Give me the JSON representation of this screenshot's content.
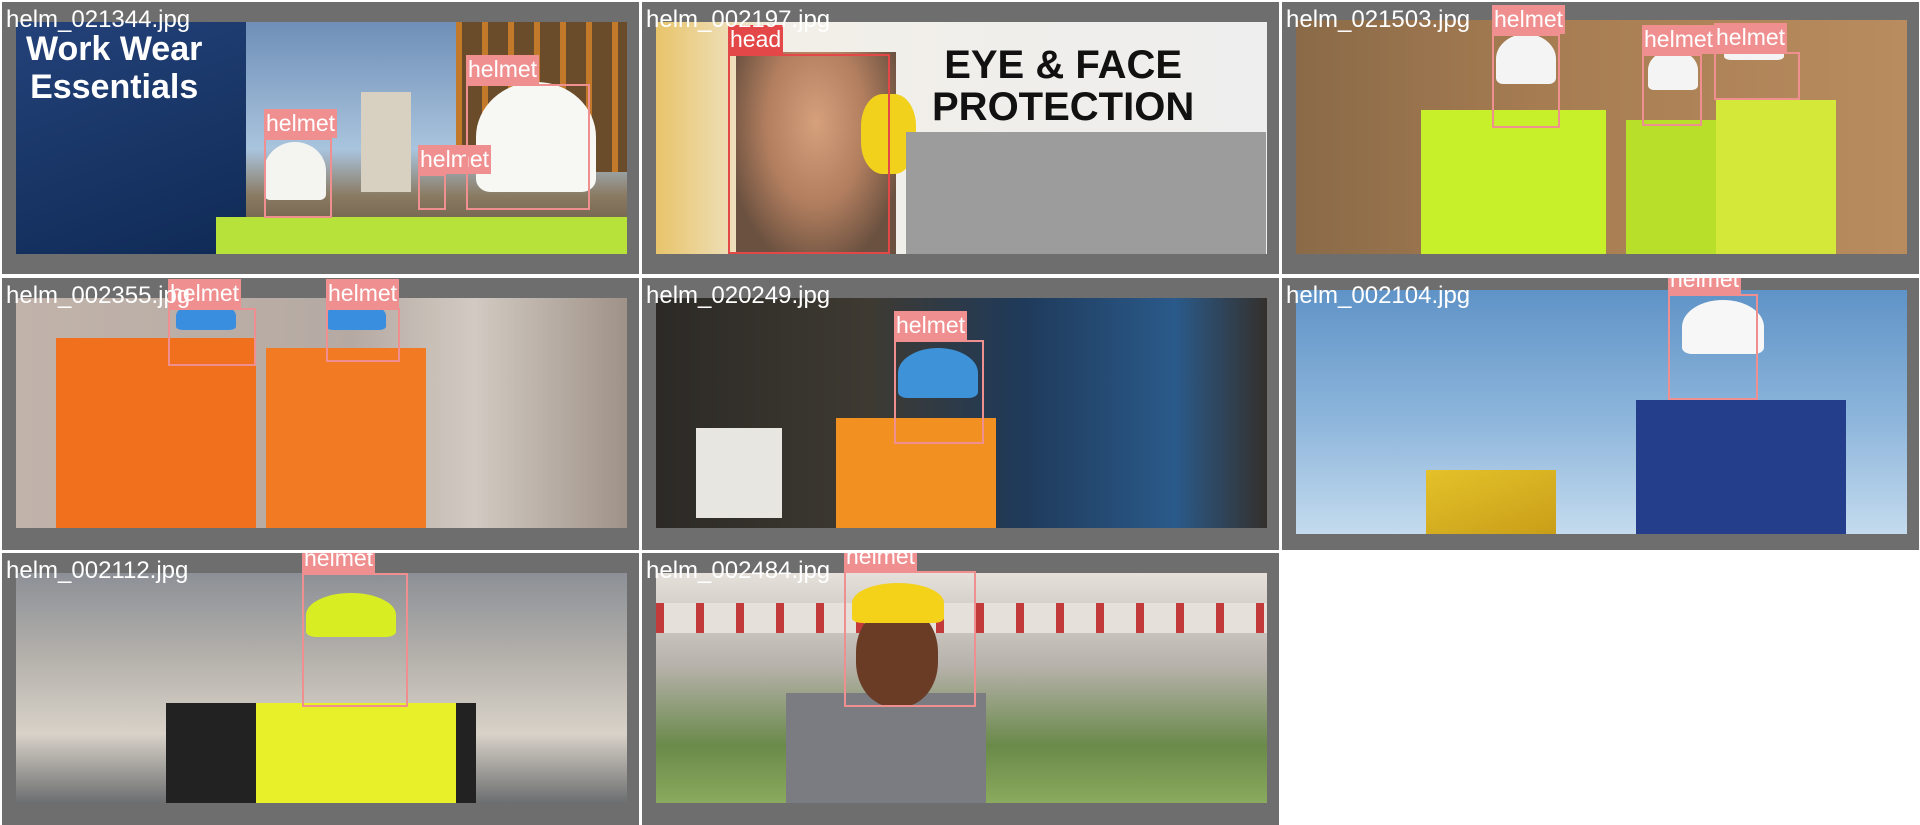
{
  "colors": {
    "cell_bg": "#6e6e6e",
    "helmet_box": "#f08f8f",
    "head_box": "#e34747",
    "label_text": "#ffffff"
  },
  "tiles": [
    {
      "filename": "helm_021344.jpg",
      "overlay_text": "Work Wear\nEssentials",
      "detections": [
        {
          "label": "helmet",
          "class": "helmet"
        },
        {
          "label": "helmet",
          "class": "helmet"
        },
        {
          "label": "helmet",
          "class": "helmet"
        }
      ]
    },
    {
      "filename": "helm_002197.jpg",
      "overlay_text": "EYE & FACE\nPROTECTION",
      "detections": [
        {
          "label": "head",
          "class": "head"
        }
      ]
    },
    {
      "filename": "helm_021503.jpg",
      "detections": [
        {
          "label": "helmet",
          "class": "helmet"
        },
        {
          "label": "helmet",
          "class": "helmet"
        },
        {
          "label": "helmet",
          "class": "helmet"
        }
      ]
    },
    {
      "filename": "helm_002355.jpg",
      "detections": [
        {
          "label": "helmet",
          "class": "helmet"
        },
        {
          "label": "helmet",
          "class": "helmet"
        }
      ]
    },
    {
      "filename": "helm_020249.jpg",
      "detections": [
        {
          "label": "helmet",
          "class": "helmet"
        }
      ]
    },
    {
      "filename": "helm_002104.jpg",
      "detections": [
        {
          "label": "helmet",
          "class": "helmet"
        }
      ]
    },
    {
      "filename": "helm_002112.jpg",
      "detections": [
        {
          "label": "helmet",
          "class": "helmet"
        }
      ]
    },
    {
      "filename": "helm_002484.jpg",
      "detections": [
        {
          "label": "helmet",
          "class": "helmet"
        }
      ]
    }
  ]
}
